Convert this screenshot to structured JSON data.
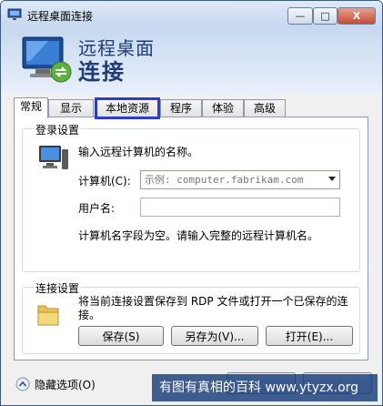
{
  "window": {
    "title": "远程桌面连接",
    "minimize_symbol": "—",
    "maximize_symbol": "□",
    "close_symbol": "X"
  },
  "header": {
    "line1": "远程桌面",
    "line2": "连接"
  },
  "tabs": [
    {
      "label": "常规",
      "active": true
    },
    {
      "label": "显示",
      "active": false
    },
    {
      "label": "本地资源",
      "active": false,
      "highlighted": true
    },
    {
      "label": "程序",
      "active": false
    },
    {
      "label": "体验",
      "active": false
    },
    {
      "label": "高级",
      "active": false
    }
  ],
  "login": {
    "group_title": "登录设置",
    "prompt": "输入远程计算机的名称。",
    "computer_label": "计算机(C):",
    "computer_placeholder": "示例: computer.fabrikam.com",
    "username_label": "用户名:",
    "username_value": "",
    "warning": "计算机名字段为空。请输入完整的远程计算机名。"
  },
  "connection": {
    "group_title": "连接设置",
    "description": "将当前连接设置保存到 RDP 文件或打开一个已保存的连接。",
    "save_label": "保存(S)",
    "save_as_label": "另存为(V)...",
    "open_label": "打开(E)..."
  },
  "footer": {
    "hide_options": "隐藏选项(O)"
  },
  "watermark": "有图有真相的百科 www.ytyzx.org",
  "colors": {
    "highlight_border": "#2e3ad4",
    "header_text": "#1e3b7a",
    "watermark_bg": "#163a78"
  }
}
